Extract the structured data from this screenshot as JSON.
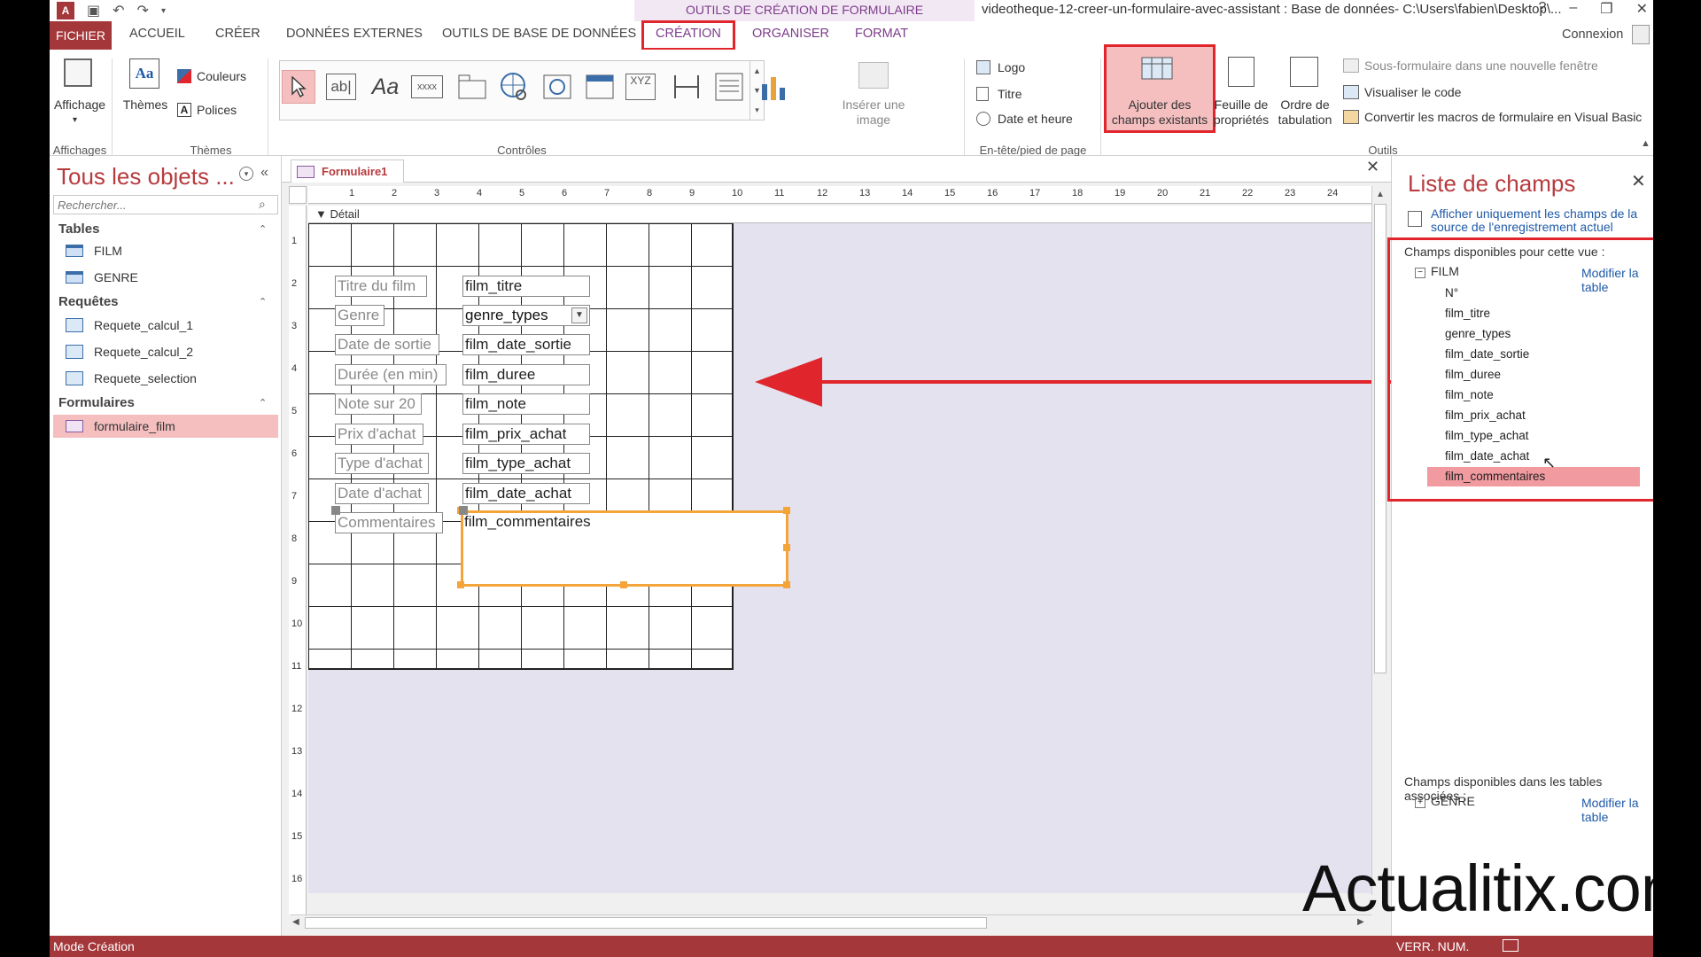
{
  "title": {
    "context_tab": "OUTILS DE CRÉATION DE FORMULAIRE",
    "document": "videotheque-12-creer-un-formulaire-avec-assistant : Base de données- C:\\Users\\fabien\\Desktop\\...",
    "help": "?",
    "connexion": "Connexion"
  },
  "tabs": [
    "FICHIER",
    "ACCUEIL",
    "CRÉER",
    "DONNÉES EXTERNES",
    "OUTILS DE BASE DE DONNÉES",
    "CRÉATION",
    "ORGANISER",
    "FORMAT"
  ],
  "ribbon": {
    "affichage": "Affichage",
    "themes": "Thèmes",
    "couleurs": "Couleurs",
    "polices": "Polices",
    "inserer_image": "Insérer une image",
    "logo": "Logo",
    "titre": "Titre",
    "date_heure": "Date et heure",
    "ajouter_champs": "Ajouter des champs existants",
    "feuille_proprietes": "Feuille de propriétés",
    "ordre_tabulation": "Ordre de tabulation",
    "sous_formulaire": "Sous-formulaire dans une nouvelle fenêtre",
    "visualiser_code": "Visualiser le code",
    "convertir_macros": "Convertir les macros de formulaire en Visual Basic",
    "groups": {
      "affichages": "Affichages",
      "themes": "Thèmes",
      "controles": "Contrôles",
      "entete": "En-tête/pied de page",
      "outils": "Outils"
    },
    "ctrl_text_ab": "ab|",
    "ctrl_text_aa": "Aa",
    "ctrl_text_xxxx": "xxxx",
    "ctrl_text_xyz": "XYZ"
  },
  "nav": {
    "title": "Tous les objets ...",
    "search_placeholder": "Rechercher...",
    "sections": {
      "tables": "Tables",
      "requetes": "Requêtes",
      "formulaires": "Formulaires"
    },
    "tables": [
      "FILM",
      "GENRE"
    ],
    "requetes": [
      "Requete_calcul_1",
      "Requete_calcul_2",
      "Requete_selection"
    ],
    "formulaires": [
      "formulaire_film"
    ]
  },
  "document": {
    "tab": "Formulaire1",
    "section": "Détail",
    "hruler_labels": [
      "1",
      "2",
      "3",
      "4",
      "5",
      "6",
      "7",
      "8",
      "9",
      "10",
      "11",
      "12",
      "13",
      "14",
      "15",
      "16",
      "17",
      "18",
      "19",
      "20",
      "21",
      "22",
      "23",
      "24"
    ],
    "vruler_labels": [
      "1",
      "2",
      "3",
      "4",
      "5",
      "6",
      "7",
      "8",
      "9",
      "10",
      "11",
      "12",
      "13",
      "14",
      "15",
      "16"
    ],
    "labels": [
      "Titre du film",
      "Genre",
      "Date de sortie",
      "Durée (en min)",
      "Note sur 20",
      "Prix d'achat",
      "Type d'achat",
      "Date d'achat",
      "Commentaires"
    ],
    "fields": [
      "film_titre",
      "genre_types",
      "film_date_sortie",
      "film_duree",
      "film_note",
      "film_prix_achat",
      "film_type_achat",
      "film_date_achat",
      "film_commentaires"
    ]
  },
  "fieldlist": {
    "title": "Liste de champs",
    "show_only": "Afficher uniquement les champs de la source de l'enregistrement actuel",
    "available": "Champs disponibles pour cette vue :",
    "table": "FILM",
    "edit_table": "Modifier la table",
    "fields": [
      "N°",
      "film_titre",
      "genre_types",
      "film_date_sortie",
      "film_duree",
      "film_note",
      "film_prix_achat",
      "film_type_achat",
      "film_date_achat",
      "film_commentaires"
    ],
    "related": "Champs disponibles dans les tables associées :",
    "related_table": "GENRE",
    "related_edit": "Modifier la table"
  },
  "status": {
    "mode": "Mode Création",
    "verr": "VERR. NUM."
  },
  "watermark": "Actualitix.com",
  "colors": {
    "accent": "#a4373a",
    "highlight": "#e0262c",
    "selection": "#f3a53a"
  }
}
